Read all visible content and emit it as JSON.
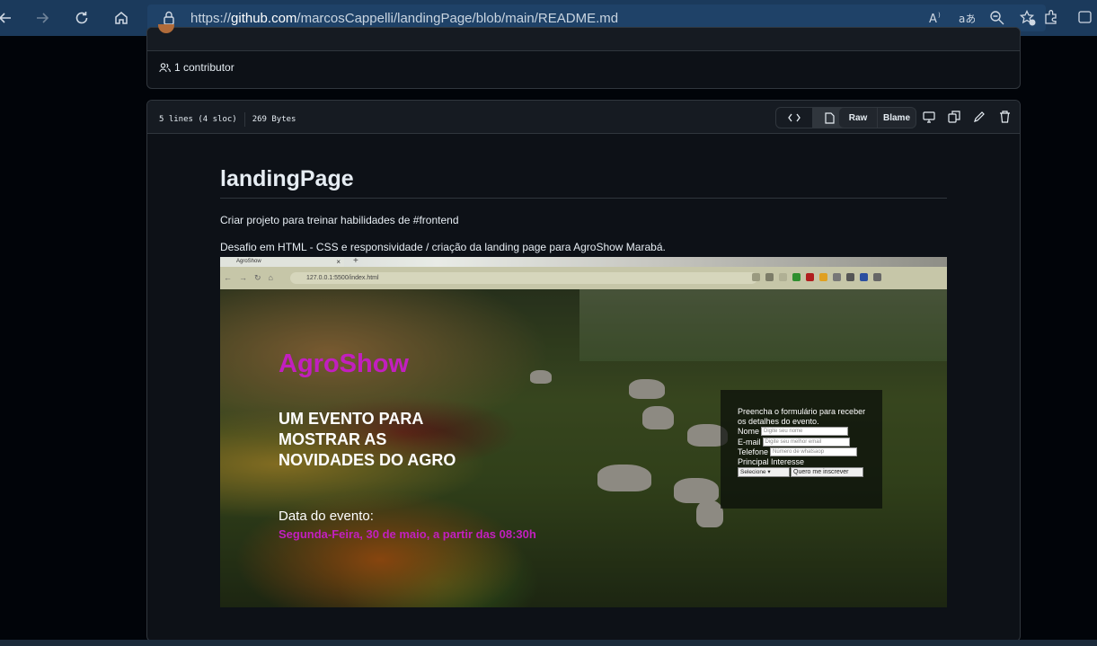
{
  "browser": {
    "url_scheme": "https://",
    "url_host": "github.com",
    "url_path": "/marcosCappelli/landingPage/blob/main/README.md",
    "icons": [
      "back-icon",
      "forward-icon",
      "refresh-icon",
      "home-icon",
      "lock-icon",
      "read-aloud-icon",
      "translate-icon",
      "zoom-icon",
      "favorite-icon",
      "extensions-icon",
      "collections-icon"
    ]
  },
  "contributors": {
    "label": "1 contributor"
  },
  "file": {
    "lines": "5 lines (4 sloc)",
    "size": "269 Bytes",
    "raw_label": "Raw",
    "blame_label": "Blame"
  },
  "readme": {
    "title": "landingPage",
    "para1": "Criar projeto para treinar habilidades de #frontend",
    "para2": "Desafio em HTML - CSS e responsividade / criação da landing page para AgroShow Marabá."
  },
  "embedded": {
    "tab_title": "AgroShow",
    "tab_close": "×",
    "tab_new": "+",
    "url": "127.0.0.1:5500/index.html",
    "brand": "AgroShow",
    "headline": "UM EVENTO PARA MOSTRAR AS NOVIDADES DO AGRO",
    "date_label": "Data do evento:",
    "date_value": "Segunda-Feira, 30 de maio, a partir das 08:30h",
    "form": {
      "intro": "Preencha o formulário para receber os detalhes do evento.",
      "name_label": "Nome",
      "name_placeholder": "Digite seu nome",
      "email_label": "E-mail",
      "email_placeholder": "Digite seu melhor email",
      "phone_label": "Telefone",
      "phone_placeholder": "Número de whatsaop",
      "interest_label": "Principal Interesse",
      "select_value": "Selecione",
      "submit_label": "Quero me inscrever"
    }
  },
  "colors": {
    "brand_magenta": "#c21fbf",
    "github_bg": "#0d1117",
    "border": "#30363d",
    "browser_bar": "#1b3a5c"
  }
}
